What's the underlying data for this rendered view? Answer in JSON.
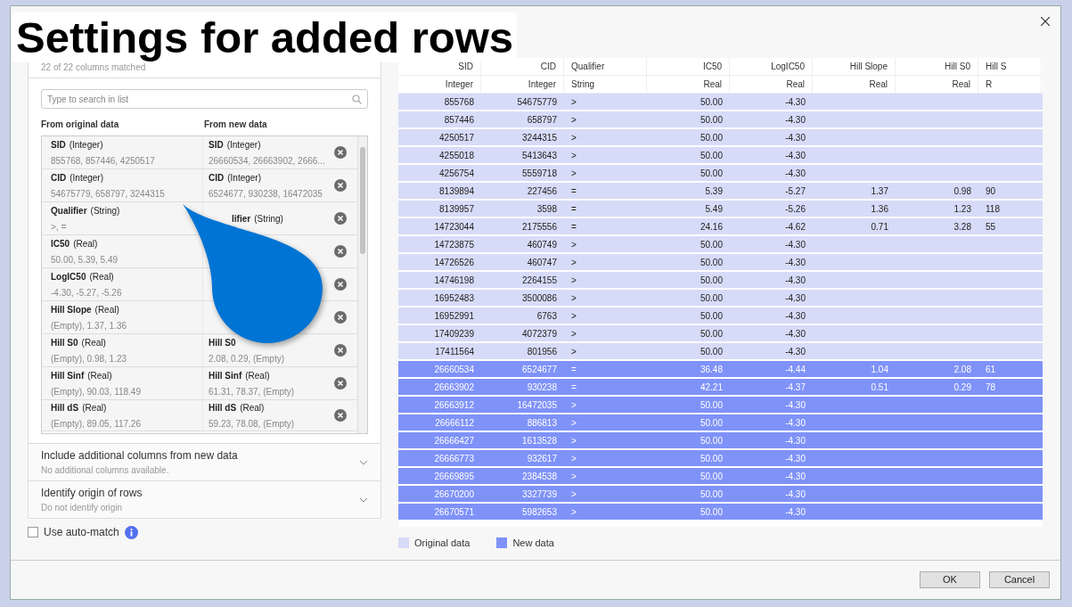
{
  "annotation": {
    "title": "Settings for added rows"
  },
  "left_panel": {
    "match_summary": "22 of 22 columns matched",
    "search": {
      "placeholder": "Type to search in list"
    },
    "column_headings": [
      "From original data",
      "From new data"
    ],
    "mappings": [
      {
        "original": {
          "name": "SID",
          "type": "(Integer)",
          "values": "855768, 857446, 4250517"
        },
        "new": {
          "name": "SID",
          "type": "(Integer)",
          "values": "26660534, 26663902, 2666..."
        }
      },
      {
        "original": {
          "name": "CID",
          "type": "(Integer)",
          "values": "54675779, 658797, 3244315"
        },
        "new": {
          "name": "CID",
          "type": "(Integer)",
          "values": "6524677, 930238, 16472035"
        }
      },
      {
        "original": {
          "name": "Qualifier",
          "type": "(String)",
          "values": ">, ="
        },
        "new": {
          "name": "lifier",
          "type": "(String)",
          "partly_covered": true
        }
      },
      {
        "original": {
          "name": "IC50",
          "type": "(Real)",
          "values": "50.00, 5.39, 5.49"
        }
      },
      {
        "original": {
          "name": "LogIC50",
          "type": "(Real)",
          "values": "-4.30, -5.27, -5.26"
        }
      },
      {
        "original": {
          "name": "Hill Slope",
          "type": "(Real)",
          "values": "(Empty), 1.37, 1.36"
        }
      },
      {
        "original": {
          "name": "Hill S0",
          "type": "(Real)",
          "values": "(Empty), 0.98, 1.23"
        },
        "new": {
          "name": "Hill S0",
          "values": "2.08, 0.29, (Empty)"
        }
      },
      {
        "original": {
          "name": "Hill Sinf",
          "type": "(Real)",
          "values": "(Empty), 90.03, 118.49"
        },
        "new": {
          "name": "Hill Sinf",
          "type": "(Real)",
          "values": "61.31, 78.37, (Empty)"
        }
      },
      {
        "original": {
          "name": "Hill dS",
          "type": "(Real)",
          "values": "(Empty), 89.05, 117.26"
        },
        "new": {
          "name": "Hill dS",
          "type": "(Real)",
          "values": "59.23, 78.08, (Empty)"
        }
      }
    ],
    "sections": [
      {
        "title": "Include additional columns from new data",
        "subtitle": "No additional columns available.",
        "expanded": false
      },
      {
        "title": "Identify origin of rows",
        "subtitle": "Do not identify origin",
        "expanded": false
      }
    ],
    "auto_match": {
      "label": "Use auto-match",
      "checked": false
    }
  },
  "table": {
    "columns": [
      {
        "name": "SID",
        "type": "Integer",
        "kind": "number"
      },
      {
        "name": "CID",
        "type": "Integer",
        "kind": "number"
      },
      {
        "name": "Qualifier",
        "type": "String",
        "kind": "text"
      },
      {
        "name": "IC50",
        "type": "Real",
        "kind": "number"
      },
      {
        "name": "LogIC50",
        "type": "Real",
        "kind": "number"
      },
      {
        "name": "Hill Slope",
        "type": "Real",
        "kind": "number"
      },
      {
        "name": "Hill S0",
        "type": "Real",
        "kind": "number"
      },
      {
        "name": "Hill S",
        "type": "R",
        "kind": "cut"
      }
    ],
    "rows": [
      {
        "kind": "original",
        "cells": [
          "855768",
          "54675779",
          ">",
          "50.00",
          "-4.30",
          null,
          null,
          null
        ]
      },
      {
        "kind": "original",
        "cells": [
          "857446",
          "658797",
          ">",
          "50.00",
          "-4.30",
          null,
          null,
          null
        ]
      },
      {
        "kind": "original",
        "cells": [
          "4250517",
          "3244315",
          ">",
          "50.00",
          "-4.30",
          null,
          null,
          null
        ]
      },
      {
        "kind": "original",
        "cells": [
          "4255018",
          "5413643",
          ">",
          "50.00",
          "-4.30",
          null,
          null,
          null
        ]
      },
      {
        "kind": "original",
        "cells": [
          "4256754",
          "5559718",
          ">",
          "50.00",
          "-4.30",
          null,
          null,
          null
        ]
      },
      {
        "kind": "original",
        "cells": [
          "8139894",
          "227456",
          "=",
          "5.39",
          "-5.27",
          "1.37",
          "0.98",
          "90"
        ]
      },
      {
        "kind": "original",
        "cells": [
          "8139957",
          "3598",
          "=",
          "5.49",
          "-5.26",
          "1.36",
          "1.23",
          "118"
        ]
      },
      {
        "kind": "original",
        "cells": [
          "14723044",
          "2175556",
          "=",
          "24.16",
          "-4.62",
          "0.71",
          "3.28",
          "55"
        ]
      },
      {
        "kind": "original",
        "cells": [
          "14723875",
          "460749",
          ">",
          "50.00",
          "-4.30",
          null,
          null,
          null
        ]
      },
      {
        "kind": "original",
        "cells": [
          "14726526",
          "460747",
          ">",
          "50.00",
          "-4.30",
          null,
          null,
          null
        ]
      },
      {
        "kind": "original",
        "cells": [
          "14746198",
          "2264155",
          ">",
          "50.00",
          "-4.30",
          null,
          null,
          null
        ]
      },
      {
        "kind": "original",
        "cells": [
          "16952483",
          "3500086",
          ">",
          "50.00",
          "-4.30",
          null,
          null,
          null
        ]
      },
      {
        "kind": "original",
        "cells": [
          "16952991",
          "6763",
          ">",
          "50.00",
          "-4.30",
          null,
          null,
          null
        ]
      },
      {
        "kind": "original",
        "cells": [
          "17409239",
          "4072379",
          ">",
          "50.00",
          "-4.30",
          null,
          null,
          null
        ]
      },
      {
        "kind": "original",
        "cells": [
          "17411564",
          "801956",
          ">",
          "50.00",
          "-4.30",
          null,
          null,
          null
        ]
      },
      {
        "kind": "new",
        "cells": [
          "26660534",
          "6524677",
          "=",
          "36.48",
          "-4.44",
          "1.04",
          "2.08",
          "61"
        ]
      },
      {
        "kind": "new",
        "cells": [
          "26663902",
          "930238",
          "=",
          "42.21",
          "-4.37",
          "0.51",
          "0.29",
          "78"
        ]
      },
      {
        "kind": "new",
        "cells": [
          "26663912",
          "16472035",
          ">",
          "50.00",
          "-4.30",
          null,
          null,
          null
        ]
      },
      {
        "kind": "new",
        "cells": [
          "26666112",
          "886813",
          ">",
          "50.00",
          "-4.30",
          null,
          null,
          null
        ]
      },
      {
        "kind": "new",
        "cells": [
          "26666427",
          "1613528",
          ">",
          "50.00",
          "-4.30",
          null,
          null,
          null
        ]
      },
      {
        "kind": "new",
        "cells": [
          "26666773",
          "932617",
          ">",
          "50.00",
          "-4.30",
          null,
          null,
          null
        ]
      },
      {
        "kind": "new",
        "cells": [
          "26669895",
          "2384538",
          ">",
          "50.00",
          "-4.30",
          null,
          null,
          null
        ]
      },
      {
        "kind": "new",
        "cells": [
          "26670200",
          "3327739",
          ">",
          "50.00",
          "-4.30",
          null,
          null,
          null
        ]
      },
      {
        "kind": "new",
        "cells": [
          "26670571",
          "5982653",
          ">",
          "50.00",
          "-4.30",
          null,
          null,
          null
        ]
      }
    ]
  },
  "legend": [
    {
      "label": "Original data",
      "color": "#d6dbf8"
    },
    {
      "label": "New data",
      "color": "#7f92f8"
    }
  ],
  "buttons": [
    "OK",
    "Cancel"
  ]
}
